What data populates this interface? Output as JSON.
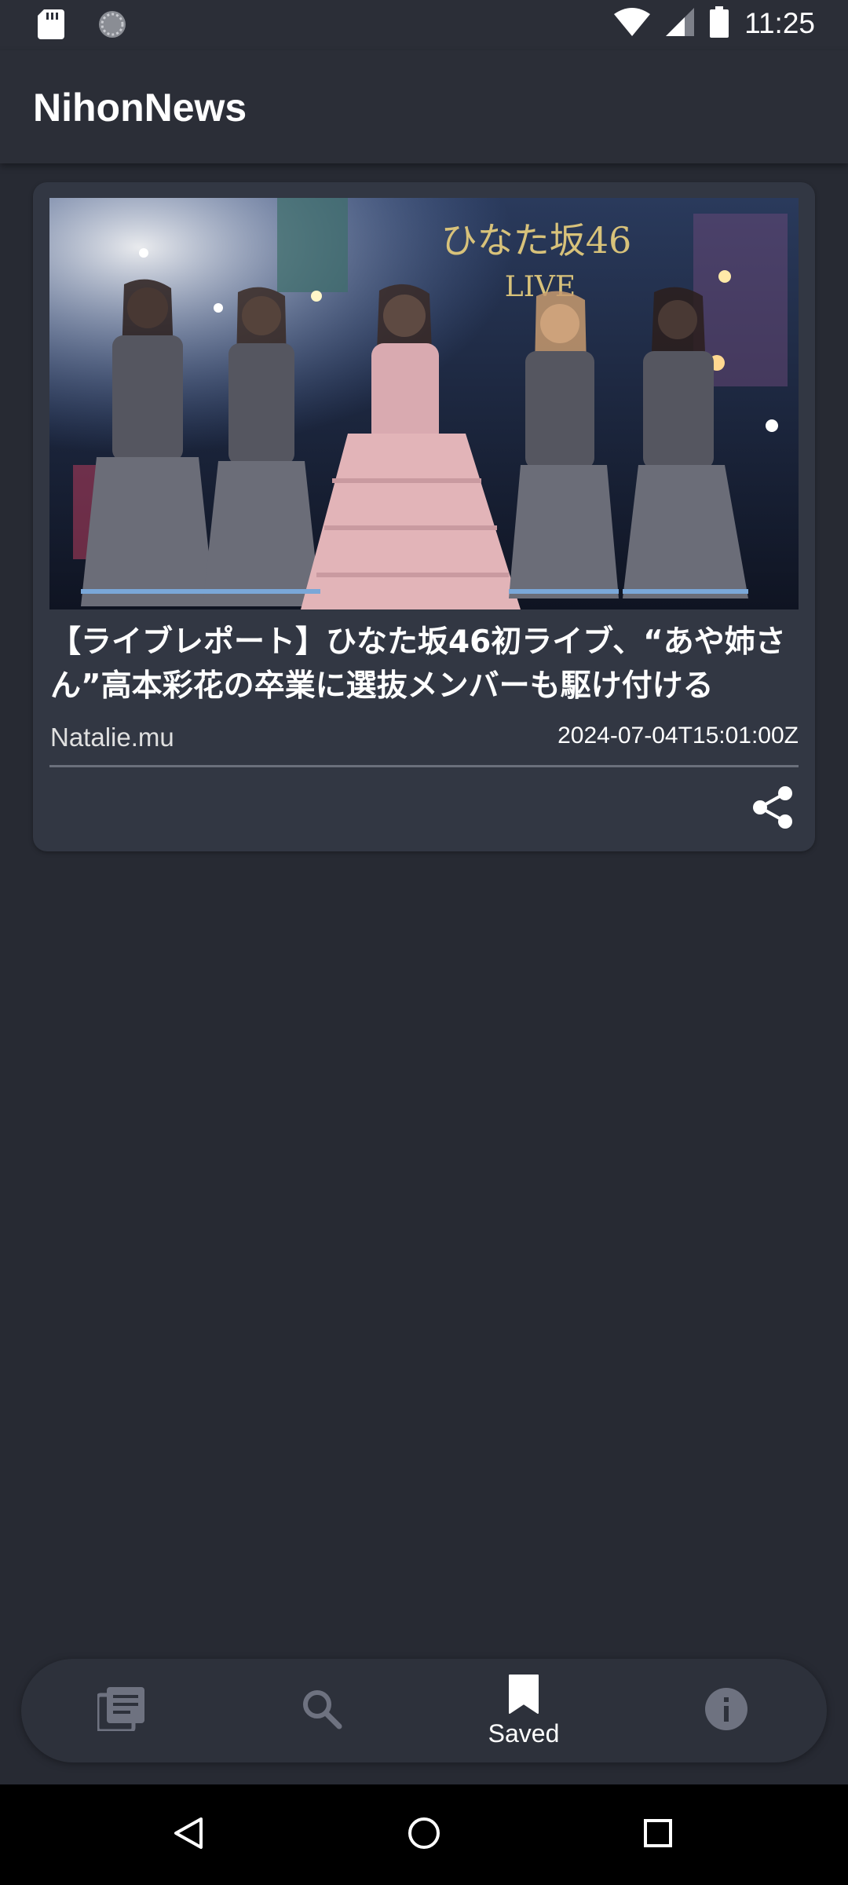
{
  "status_bar": {
    "time": "11:25",
    "icons": [
      "sd-card-icon",
      "sync-icon",
      "wifi-icon",
      "signal-icon",
      "battery-icon"
    ]
  },
  "app_bar": {
    "title": "NihonNews"
  },
  "articles": [
    {
      "title": "【ライブレポート】ひなた坂46初ライブ、“あや姉さん”高本彩花の卒業に選抜メンバーも駆け付ける",
      "image_text": "ひなた坂46 LIVE",
      "source": "Natalie.mu",
      "date": "2024-07-04T15:01:00Z",
      "share_icon": "share-icon"
    }
  ],
  "bottom_nav": {
    "items": [
      {
        "icon": "news-icon",
        "label": "",
        "active": false
      },
      {
        "icon": "search-icon",
        "label": "",
        "active": false
      },
      {
        "icon": "bookmark-icon",
        "label": "Saved",
        "active": true
      },
      {
        "icon": "info-icon",
        "label": "",
        "active": false
      }
    ]
  },
  "system_nav": {
    "buttons": [
      "back-icon",
      "home-icon",
      "recents-icon"
    ]
  },
  "colors": {
    "background": "#272a33",
    "card": "#323743",
    "nav_inactive": "#6e7280",
    "text": "#ffffff"
  }
}
